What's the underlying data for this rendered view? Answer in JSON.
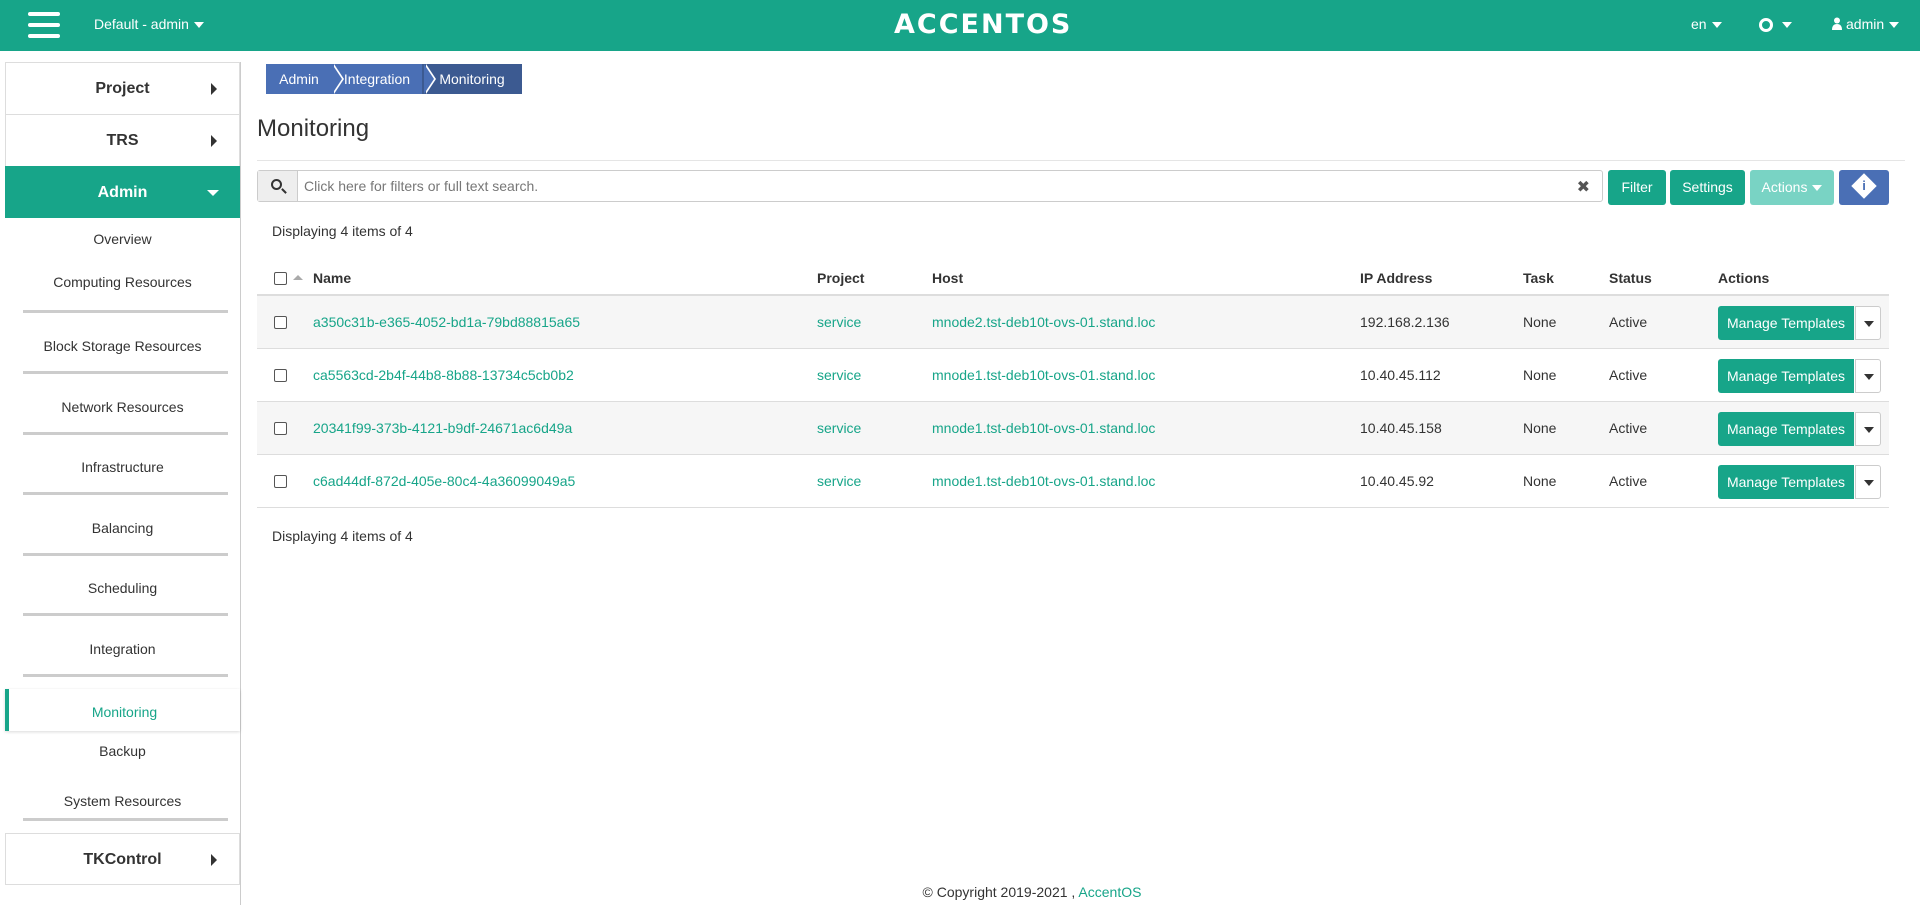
{
  "header": {
    "project_switch": "Default - admin",
    "logo": "ACCENTOS",
    "language": "en",
    "user": "admin"
  },
  "sidebar": {
    "top": [
      {
        "label": "Project"
      },
      {
        "label": "TRS"
      },
      {
        "label": "Admin"
      },
      {
        "label": "TKControl"
      }
    ],
    "admin_items": [
      {
        "label": "Overview"
      },
      {
        "label": "Computing Resources"
      },
      {
        "label": "Block Storage Resources"
      },
      {
        "label": "Network Resources"
      },
      {
        "label": "Infrastructure"
      },
      {
        "label": "Balancing"
      },
      {
        "label": "Scheduling"
      },
      {
        "label": "Integration"
      },
      {
        "label": "Monitoring"
      },
      {
        "label": "Backup"
      },
      {
        "label": "System Resources"
      }
    ]
  },
  "breadcrumb": [
    "Admin",
    "Integration",
    "Monitoring"
  ],
  "page_title": "Monitoring",
  "search": {
    "placeholder": "Click here for filters or full text search."
  },
  "toolbar": {
    "filter": "Filter",
    "settings": "Settings",
    "actions": "Actions"
  },
  "count_text": "Displaying 4 items of 4",
  "table": {
    "columns": [
      "Name",
      "Project",
      "Host",
      "IP Address",
      "Task",
      "Status",
      "Actions"
    ],
    "rows": [
      {
        "name": "a350c31b-e365-4052-bd1a-79bd88815a65",
        "project": "service",
        "host": "mnode2.tst-deb10t-ovs-01.stand.loc",
        "ip": "192.168.2.136",
        "task": "None",
        "status": "Active",
        "action": "Manage Templates"
      },
      {
        "name": "ca5563cd-2b4f-44b8-8b88-13734c5cb0b2",
        "project": "service",
        "host": "mnode1.tst-deb10t-ovs-01.stand.loc",
        "ip": "10.40.45.112",
        "task": "None",
        "status": "Active",
        "action": "Manage Templates"
      },
      {
        "name": "20341f99-373b-4121-b9df-24671ac6d49a",
        "project": "service",
        "host": "mnode1.tst-deb10t-ovs-01.stand.loc",
        "ip": "10.40.45.158",
        "task": "None",
        "status": "Active",
        "action": "Manage Templates"
      },
      {
        "name": "c6ad44df-872d-405e-80c4-4a36099049a5",
        "project": "service",
        "host": "mnode1.tst-deb10t-ovs-01.stand.loc",
        "ip": "10.40.45.92",
        "task": "None",
        "status": "Active",
        "action": "Manage Templates"
      }
    ]
  },
  "footer": {
    "copyright": "© Copyright 2019-2021 ,",
    "brand": "AccentOS"
  },
  "colors": {
    "primary": "#17a589",
    "breadcrumb": "#4a6fb5",
    "breadcrumb_active": "#3c5a91"
  }
}
